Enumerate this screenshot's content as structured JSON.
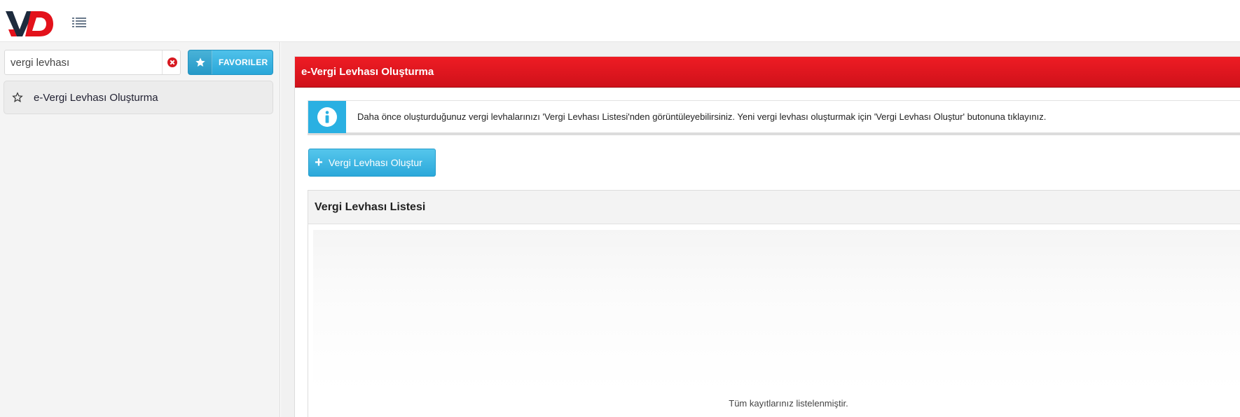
{
  "header": {
    "logo_text": "VD",
    "menu_icon": "list-icon"
  },
  "sidebar": {
    "search": {
      "value": "vergi levhası",
      "clear_icon": "close-circle-icon"
    },
    "favorites_button": {
      "label": "FAVORILER",
      "icon": "star-icon"
    },
    "items": [
      {
        "label": "e-Vergi Levhası Oluşturma",
        "icon": "star-outline-icon"
      }
    ]
  },
  "main": {
    "panel_title": "e-Vergi Levhası Oluşturma",
    "info": {
      "icon": "info-icon",
      "text": "Daha önce oluşturduğunuz vergi levhalarınızı 'Vergi Levhası Listesi'nden görüntüleyebilirsiniz. Yeni vergi levhası oluşturmak için 'Vergi Levhası Oluştur' butonuna tıklayınız."
    },
    "create_button": {
      "label": "Vergi Levhası Oluştur",
      "icon": "plus-icon"
    },
    "list": {
      "title": "Vergi Levhası Listesi",
      "filter_icon": "filter-icon",
      "footer": "Tüm kayıtlarınız listelenmiştir."
    }
  },
  "colors": {
    "brand_red": "#e3121b",
    "accent_blue": "#2ab0e2"
  }
}
